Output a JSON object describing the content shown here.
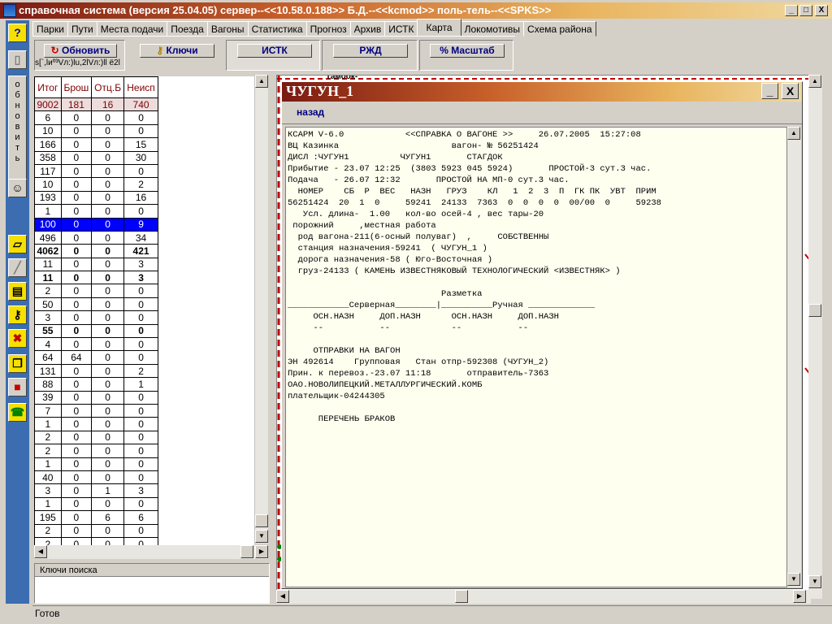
{
  "window": {
    "title": "справочная система (версия 25.04.05) сервер--<<10.58.0.188>> Б.Д.--<<kcmod>> поль-тель--<<SPKS>>",
    "min": "_",
    "max": "□",
    "close": "X"
  },
  "toolbar": {
    "help": "?",
    "refresh_vertical": "обновить"
  },
  "tabs": [
    "Парки",
    "Пути",
    "Места подачи",
    "Поезда",
    "Вагоны",
    "Статистика",
    "Прогноз",
    "Архив",
    "ИСТК",
    "Карта",
    "Локомотивы",
    "Схема района"
  ],
  "buttons": {
    "refresh": "Обновить",
    "refresh_sub": "s[`,lиº³Vл:)lu,2lVл:)ll ё2l",
    "keys": "Ключи",
    "istk": "ИСТК",
    "rzd": "РЖД",
    "scale": "Масштаб",
    "scale_icon": "%"
  },
  "table": {
    "headers": [
      "Итог",
      "Брош",
      "Отц.Б",
      "Неисп"
    ],
    "total": [
      "9002",
      "181",
      "16",
      "740"
    ],
    "rows": [
      {
        "v": [
          "6",
          "0",
          "0",
          "0"
        ],
        "cls": ""
      },
      {
        "v": [
          "10",
          "0",
          "0",
          "0"
        ],
        "cls": ""
      },
      {
        "v": [
          "166",
          "0",
          "0",
          "15"
        ],
        "cls": ""
      },
      {
        "v": [
          "358",
          "0",
          "0",
          "30"
        ],
        "cls": ""
      },
      {
        "v": [
          "117",
          "0",
          "0",
          "0"
        ],
        "cls": ""
      },
      {
        "v": [
          "10",
          "0",
          "0",
          "2"
        ],
        "cls": ""
      },
      {
        "v": [
          "193",
          "0",
          "0",
          "16"
        ],
        "cls": ""
      },
      {
        "v": [
          "1",
          "0",
          "0",
          "0"
        ],
        "cls": ""
      },
      {
        "v": [
          "100",
          "0",
          "0",
          "9"
        ],
        "cls": "sel"
      },
      {
        "v": [
          "496",
          "0",
          "0",
          "34"
        ],
        "cls": ""
      },
      {
        "v": [
          "4062",
          "0",
          "0",
          "421"
        ],
        "cls": "b"
      },
      {
        "v": [
          "11",
          "0",
          "0",
          "3"
        ],
        "cls": ""
      },
      {
        "v": [
          "11",
          "0",
          "0",
          "3"
        ],
        "cls": "b"
      },
      {
        "v": [
          "2",
          "0",
          "0",
          "0"
        ],
        "cls": ""
      },
      {
        "v": [
          "50",
          "0",
          "0",
          "0"
        ],
        "cls": ""
      },
      {
        "v": [
          "3",
          "0",
          "0",
          "0"
        ],
        "cls": ""
      },
      {
        "v": [
          "55",
          "0",
          "0",
          "0"
        ],
        "cls": "b"
      },
      {
        "v": [
          "4",
          "0",
          "0",
          "0"
        ],
        "cls": ""
      },
      {
        "v": [
          "64",
          "64",
          "0",
          "0"
        ],
        "cls": ""
      },
      {
        "v": [
          "131",
          "0",
          "0",
          "2"
        ],
        "cls": ""
      },
      {
        "v": [
          "88",
          "0",
          "0",
          "1"
        ],
        "cls": ""
      },
      {
        "v": [
          "39",
          "0",
          "0",
          "0"
        ],
        "cls": ""
      },
      {
        "v": [
          "7",
          "0",
          "0",
          "0"
        ],
        "cls": ""
      },
      {
        "v": [
          "1",
          "0",
          "0",
          "0"
        ],
        "cls": ""
      },
      {
        "v": [
          "2",
          "0",
          "0",
          "0"
        ],
        "cls": ""
      },
      {
        "v": [
          "2",
          "0",
          "0",
          "0"
        ],
        "cls": ""
      },
      {
        "v": [
          "1",
          "0",
          "0",
          "0"
        ],
        "cls": ""
      },
      {
        "v": [
          "40",
          "0",
          "0",
          "0"
        ],
        "cls": ""
      },
      {
        "v": [
          "3",
          "0",
          "1",
          "3"
        ],
        "cls": ""
      },
      {
        "v": [
          "1",
          "0",
          "0",
          "0"
        ],
        "cls": ""
      },
      {
        "v": [
          "195",
          "0",
          "6",
          "6"
        ],
        "cls": ""
      },
      {
        "v": [
          "2",
          "0",
          "0",
          "0"
        ],
        "cls": ""
      },
      {
        "v": [
          "2",
          "0",
          "0",
          "0"
        ],
        "cls": ""
      }
    ]
  },
  "search": {
    "header": "Ключи поиска"
  },
  "status": {
    "text": "Готов"
  },
  "dialog": {
    "title": "ЧУГУН_1",
    "back": "назад",
    "min": "_",
    "close": "X",
    "lines": [
      "КСАРМ V-6.0            <<СПРАВКА О ВАГОНЕ >>     26.07.2005  15:27:08",
      "ВЦ Казинка                      вагон- № 56251424",
      "ДИСЛ :ЧУГУН1          ЧУГУН1       СТАГДОК",
      "Прибытие - 23.07 12:25  (3803 5923 045 5924)       ПРОСТОЙ-3 сут.3 час.",
      "Подача   - 26.07 12:32       ПРОСТОЙ НА МП-0 сут.3 час.",
      "  НОМЕР    СБ  Р  ВЕС   НАЗН   ГРУЗ    КЛ   1  2  3  П  ГК ПК  УВТ  ПРИМ",
      "56251424  20  1  0     59241  24133  7363  0  0  0  0  00/00  0     59238",
      "   Усл. длина-  1.00   кол-во осей-4 , вес тары-20",
      " порожний     ,местная работа",
      "  род вагона-211(6-осный полуваг)  ,     СОБСТВЕННЫ",
      "  станция назначения-59241  ( ЧУГУН_1 )",
      "  дорога назначения-58 ( Юго-Восточная )",
      "  груз-24133 ( КАМЕНЬ ИЗВЕСТНЯКОВЫЙ ТЕХНОЛОГИЧЕСКИЙ <ИЗВЕСТНЯК> )",
      "",
      "                              Разметка",
      "____________Серверная________|__________Ручная _____________",
      "     ОСН.НАЗН     ДОП.НАЗН      ОСН.НАЗН     ДОП.НАЗН",
      "     --           --            --           --",
      "",
      "     ОТПРАВКИ НА ВАГОН",
      "ЭН 492614    Групповая   Стан отпр-592308 (ЧУГУН_2)",
      "Прин. к перевоз.-23.07 11:18       отправитель-7363",
      "ОАО.НОВОЛИПЕЦКИЙ.МЕТАЛЛУРГИЧЕСКИЙ.КОМБ",
      "плательщик-04244305",
      "",
      "      ПЕРЕЧЕНЬ БРАКОВ"
    ]
  },
  "map": {
    "top_label": "Тамоок-"
  }
}
